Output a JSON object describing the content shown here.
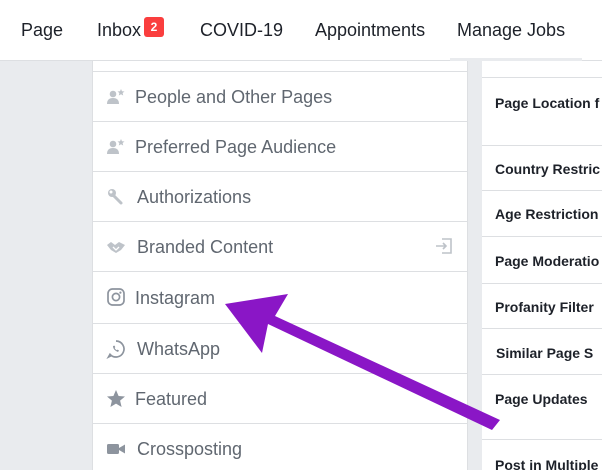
{
  "topnav": {
    "tabs": [
      {
        "label": "Page"
      },
      {
        "label": "Inbox",
        "badge": "2"
      },
      {
        "label": "COVID-19"
      },
      {
        "label": "Appointments"
      },
      {
        "label": "Manage Jobs"
      }
    ]
  },
  "leftnav": {
    "items": [
      {
        "label": "People and Other Pages",
        "icon": "people-star-icon"
      },
      {
        "label": "Preferred Page Audience",
        "icon": "people-star-icon"
      },
      {
        "label": "Authorizations",
        "icon": "wrench-icon"
      },
      {
        "label": "Branded Content",
        "icon": "handshake-icon",
        "trailing_icon": "exit-icon"
      },
      {
        "label": "Instagram",
        "icon": "instagram-icon"
      },
      {
        "label": "WhatsApp",
        "icon": "whatsapp-icon"
      },
      {
        "label": "Featured",
        "icon": "star-icon"
      },
      {
        "label": "Crossposting",
        "icon": "video-camera-icon"
      }
    ]
  },
  "rightpanel": {
    "rows": [
      {
        "label": "Page Location f"
      },
      {
        "label": "Country Restric"
      },
      {
        "label": "Age Restriction"
      },
      {
        "label": "Page Moderatio"
      },
      {
        "label": "Profanity Filter"
      },
      {
        "label": "Similar Page S"
      },
      {
        "label": "Page Updates"
      },
      {
        "label": "Post in Multiple"
      }
    ]
  },
  "annotation": {
    "arrow_color": "#8a16c6"
  }
}
